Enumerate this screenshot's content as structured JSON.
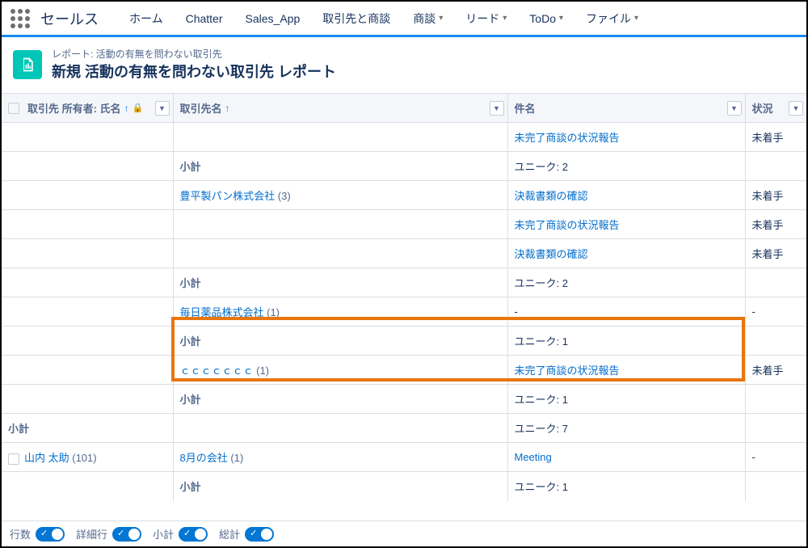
{
  "nav": {
    "app_name": "セールス",
    "items": [
      {
        "label": "ホーム",
        "dropdown": false
      },
      {
        "label": "Chatter",
        "dropdown": false
      },
      {
        "label": "Sales_App",
        "dropdown": false
      },
      {
        "label": "取引先と商談",
        "dropdown": false
      },
      {
        "label": "商談",
        "dropdown": true
      },
      {
        "label": "リード",
        "dropdown": true
      },
      {
        "label": "ToDo",
        "dropdown": true
      },
      {
        "label": "ファイル",
        "dropdown": true
      }
    ]
  },
  "header": {
    "subtitle": "レポート: 活動の有無を問わない取引先",
    "title": "新規 活動の有無を問わない取引先 レポート"
  },
  "columns": {
    "owner": "取引先 所有者: 氏名",
    "account": "取引先名",
    "subject": "件名",
    "status": "状況"
  },
  "labels": {
    "subtotal": "小計",
    "unique_prefix": "ユニーク: "
  },
  "rows": {
    "r0_subject": "未完了商談の状況報告",
    "r0_status": "未着手",
    "sub1_unique": "ユニーク: 2",
    "grp2_name": "豊平製パン株式会社",
    "grp2_count": " (3)",
    "grp2_a_subject": "決裁書類の確認",
    "grp2_a_status": "未着手",
    "grp2_b_subject": "未完了商談の状況報告",
    "grp2_b_status": "未着手",
    "grp2_c_subject": "決裁書類の確認",
    "grp2_c_status": "未着手",
    "sub2_unique": "ユニーク: 2",
    "grp3_name": "毎日薬品株式会社",
    "grp3_count": " (1)",
    "grp3_a_subject": "-",
    "grp3_a_status": "-",
    "sub3_unique": "ユニーク: 1",
    "grp4_name": "ｃｃｃｃｃｃｃ",
    "grp4_count": " (1)",
    "grp4_a_subject": "未完了商談の状況報告",
    "grp4_a_status": "未着手",
    "sub4_unique": "ユニーク: 1",
    "subg_unique": "ユニーク: 7",
    "owner2_name": "山内 太助",
    "owner2_count": " (101)",
    "grp5_name": "8月の会社",
    "grp5_count": " (1)",
    "grp5_a_subject": "Meeting",
    "grp5_a_status": "-",
    "sub5_unique": "ユニーク: 1"
  },
  "footer": {
    "rows": "行数",
    "detail": "詳細行",
    "subtotal": "小計",
    "grandtotal": "総計"
  },
  "colors": {
    "link": "#006dcc",
    "accent": "#1589ee",
    "highlight": "#e8760d"
  }
}
